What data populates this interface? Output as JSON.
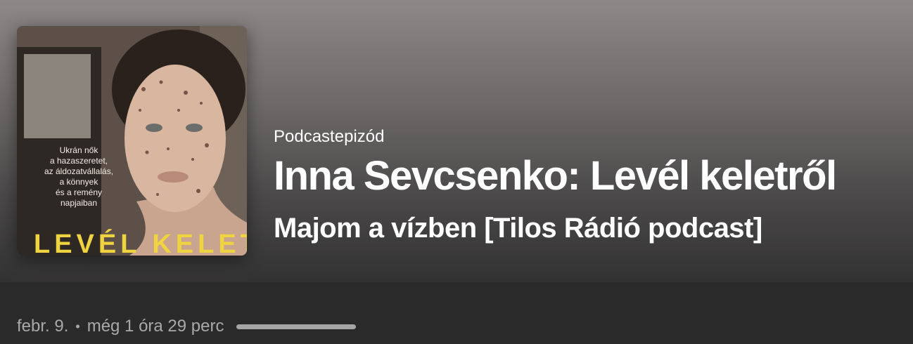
{
  "episode": {
    "type_label": "Podcastepizód",
    "title": "Inna Sevcsenko: Levél keletről",
    "show_name": "Majom a vízben [Tilos Rádió podcast]"
  },
  "cover": {
    "tagline": "Ukrán nők\na hazaszeretet,\naz áldozatvállalás,\na könnyek\nés a remény\nnapjaiban",
    "title": "LEVÉL KELETRŐL",
    "title_color": "#f0d340"
  },
  "info": {
    "date": "febr. 9.",
    "separator": "•",
    "remaining": "még 1 óra 29 perc",
    "progress_fraction": 0.0
  },
  "colors": {
    "header_top": "#8d8888",
    "header_bottom": "#333232",
    "info_bar": "#2b2a2a",
    "muted_text": "#a9a9a9"
  }
}
